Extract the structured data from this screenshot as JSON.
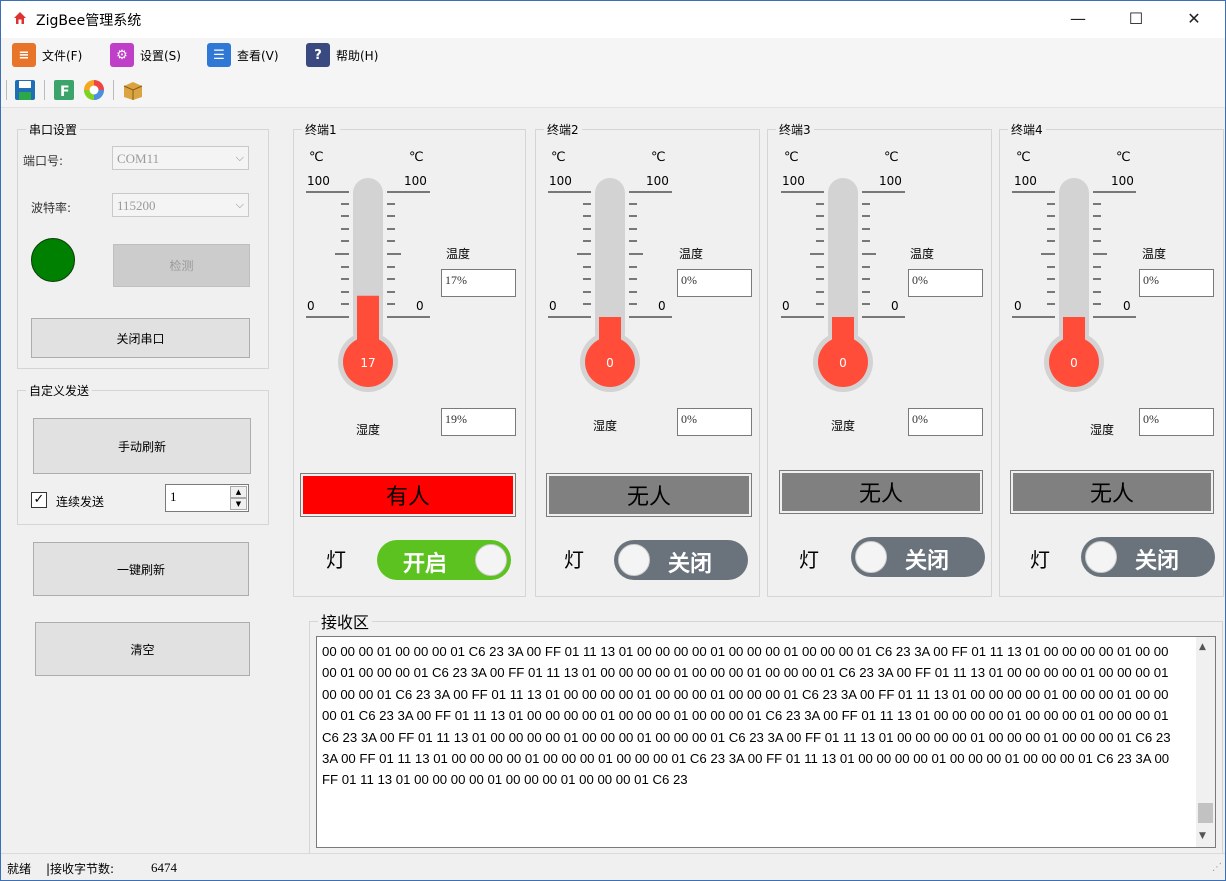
{
  "window": {
    "title": "ZigBee管理系统",
    "minimize": "—",
    "maximize": "☐",
    "close": "✕"
  },
  "menu": [
    {
      "label": "文件(F)",
      "icon": "file-icon",
      "color": "#e8742a",
      "glyph": "≡"
    },
    {
      "label": "设置(S)",
      "icon": "gear-icon",
      "color": "#c03fc8",
      "glyph": "⚙"
    },
    {
      "label": "查看(V)",
      "icon": "list-icon",
      "color": "#2f78d6",
      "glyph": "☰"
    },
    {
      "label": "帮助(H)",
      "icon": "help-icon",
      "color": "#3a4a80",
      "glyph": "?"
    }
  ],
  "toolbar": [
    "save-icon",
    "f-icon",
    "color-wheel-icon",
    "package-icon"
  ],
  "serial": {
    "legend": "串口设置",
    "port_label": "端口号:",
    "port_value": "COM11",
    "baud_label": "波特率:",
    "baud_value": "115200",
    "indicator_color": "#008000",
    "detect_label": "检测",
    "close_label": "关闭串口"
  },
  "custom": {
    "legend": "自定义发送",
    "manual_refresh": "手动刷新",
    "continuous_label": "连续发送",
    "continuous_checked": true,
    "interval_value": "1"
  },
  "one_key_refresh": "一键刷新",
  "clear_label": "清空",
  "terminals": [
    {
      "title": "终端1",
      "unit_left": "℃",
      "unit_right": "℃",
      "max": "100",
      "min": "0",
      "temp": "17",
      "temp_level": 0.17,
      "temp_label": "温度",
      "temp_value": "17%",
      "hum_label": "湿度",
      "hum_value": "19%",
      "presence": "有人",
      "presence_bg": "#ff0000",
      "light_label": "灯",
      "switch_label": "开启",
      "switch_on": true
    },
    {
      "title": "终端2",
      "unit_left": "℃",
      "unit_right": "℃",
      "max": "100",
      "min": "0",
      "temp": "0",
      "temp_level": 0,
      "temp_label": "温度",
      "temp_value": "0%",
      "hum_label": "湿度",
      "hum_value": "0%",
      "presence": "无人",
      "presence_bg": "#808080",
      "light_label": "灯",
      "switch_label": "关闭",
      "switch_on": false
    },
    {
      "title": "终端3",
      "unit_left": "℃",
      "unit_right": "℃",
      "max": "100",
      "min": "0",
      "temp": "0",
      "temp_level": 0,
      "temp_label": "温度",
      "temp_value": "0%",
      "hum_label": "湿度",
      "hum_value": "0%",
      "presence": "无人",
      "presence_bg": "#808080",
      "light_label": "灯",
      "switch_label": "关闭",
      "switch_on": false
    },
    {
      "title": "终端4",
      "unit_left": "℃",
      "unit_right": "℃",
      "max": "100",
      "min": "0",
      "temp": "0",
      "temp_level": 0,
      "temp_label": "温度",
      "temp_value": "0%",
      "hum_label": "湿度",
      "hum_value": "0%",
      "presence": "无人",
      "presence_bg": "#808080",
      "light_label": "灯",
      "switch_label": "关闭",
      "switch_on": false
    }
  ],
  "receive": {
    "legend": "接收区",
    "text": "00 00 00 01 00 00 00 01 C6 23 3A 00 FF 01 11 13 01 00 00 00 00 01 00 00 00 01 00 00 00 01 C6 23 3A 00 FF 01 11 13 01 00 00 00 00 01 00 00 00 01 00 00 00 01 C6 23 3A 00 FF 01 11 13 01 00 00 00 00 01 00 00 00 01 00 00 00 01 C6 23 3A 00 FF 01 11 13 01 00 00 00 00 01 00 00 00 01 00 00 00 01 C6 23 3A 00 FF 01 11 13 01 00 00 00 00 01 00 00 00 01 00 00 00 01 C6 23 3A 00 FF 01 11 13 01 00 00 00 00 01 00 00 00 01 00 00 00 01 C6 23 3A 00 FF 01 11 13 01 00 00 00 00 01 00 00 00 01 00 00 00 01 C6 23 3A 00 FF 01 11 13 01 00 00 00 00 01 00 00 00 01 00 00 00 01 C6 23 3A 00 FF 01 11 13 01 00 00 00 00 01 00 00 00 01 00 00 00 01 C6 23 3A 00 FF 01 11 13 01 00 00 00 00 01 00 00 00 01 00 00 00 01 C6 23 3A 00 FF 01 11 13 01 00 00 00 00 01 00 00 00 01 00 00 00 01 C6 23 3A 00 FF 01 11 13 01 00 00 00 00 01 00 00 00 01 00 00 00 01 C6 23 3A 00 FF 01 11 13 01 00 00 00 00 01 00 00 00 01 00 00 00 01 C6 23"
  },
  "statusbar": {
    "ready": "就绪",
    "bytes_label": "|接收字节数:",
    "bytes_value": "6474"
  }
}
